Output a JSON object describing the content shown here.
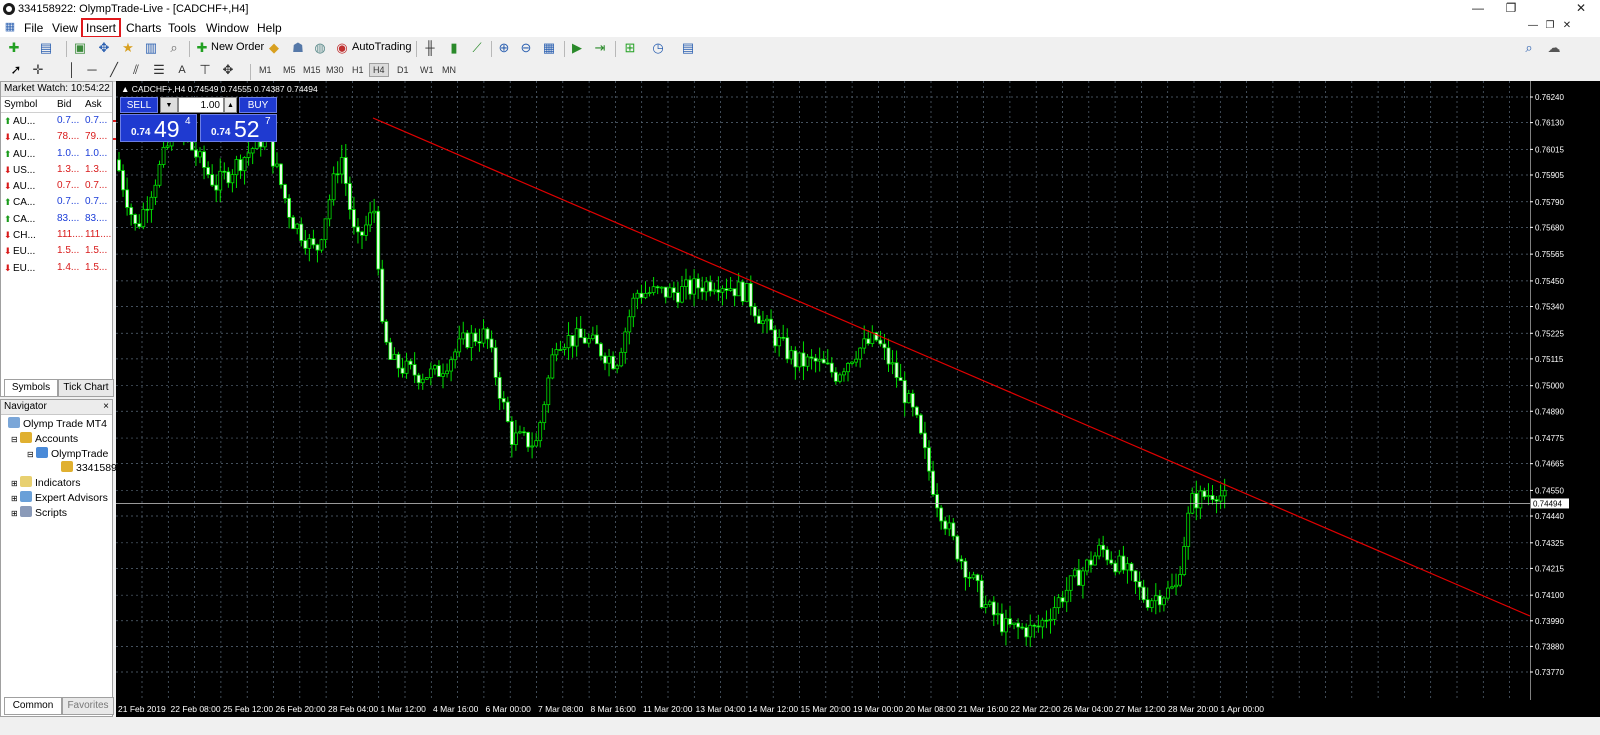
{
  "window": {
    "title": "334158922: OlympTrade-Live - [CADCHF+,H4]",
    "controls": [
      "—",
      "❐",
      "✕"
    ],
    "inner_controls": [
      "—",
      "❐",
      "✕"
    ]
  },
  "menu": {
    "items": [
      "File",
      "View",
      "Insert",
      "Charts",
      "Tools",
      "Window",
      "Help"
    ],
    "selected": "Insert"
  },
  "toolbar": {
    "new_order": "New Order",
    "autotrading": "AutoTrading"
  },
  "timeframes": [
    "M1",
    "M5",
    "M15",
    "M30",
    "H1",
    "H4",
    "D1",
    "W1",
    "MN"
  ],
  "active_timeframe": "H4",
  "market_watch": {
    "title": "Market Watch: 10:54:22",
    "columns": [
      "Symbol",
      "Bid",
      "Ask"
    ],
    "rows": [
      {
        "symbol": "AU...",
        "bid": "0.7...",
        "ask": "0.7...",
        "dir": "up",
        "color": "blue"
      },
      {
        "symbol": "AU...",
        "bid": "78....",
        "ask": "79....",
        "dir": "down",
        "color": "red"
      },
      {
        "symbol": "AU...",
        "bid": "1.0...",
        "ask": "1.0...",
        "dir": "up",
        "color": "blue"
      },
      {
        "symbol": "US...",
        "bid": "1.3...",
        "ask": "1.3...",
        "dir": "down",
        "color": "red"
      },
      {
        "symbol": "AU...",
        "bid": "0.7...",
        "ask": "0.7...",
        "dir": "down",
        "color": "red"
      },
      {
        "symbol": "CA...",
        "bid": "0.7...",
        "ask": "0.7...",
        "dir": "up",
        "color": "blue"
      },
      {
        "symbol": "CA...",
        "bid": "83....",
        "ask": "83....",
        "dir": "up",
        "color": "blue"
      },
      {
        "symbol": "CH...",
        "bid": "111....",
        "ask": "111....",
        "dir": "down",
        "color": "red"
      },
      {
        "symbol": "EU...",
        "bid": "1.5...",
        "ask": "1.5...",
        "dir": "down",
        "color": "red"
      },
      {
        "symbol": "EU...",
        "bid": "1.4...",
        "ask": "1.5...",
        "dir": "down",
        "color": "red"
      }
    ],
    "tabs": [
      "Symbols",
      "Tick Chart"
    ]
  },
  "navigator": {
    "title": "Navigator",
    "items": [
      "Olymp Trade MT4",
      "Accounts",
      "OlympTrade",
      "3341589",
      "Indicators",
      "Expert Advisors",
      "Scripts"
    ],
    "tabs": [
      "Common",
      "Favorites"
    ]
  },
  "chart": {
    "symbol_info": "▲ CADCHF+,H4  0.74549 0.74555 0.74387 0.74494",
    "trade": {
      "sell": "SELL",
      "buy": "BUY",
      "lot": "1.00",
      "bid_prefix": "0.74",
      "bid_big": "49",
      "bid_sup": "4",
      "ask_prefix": "0.74",
      "ask_big": "52",
      "ask_sup": "7"
    },
    "current_price_label": "0.74494",
    "price_labels": [
      "0.76240",
      "0.76130",
      "0.76015",
      "0.75905",
      "0.75790",
      "0.75680",
      "0.75565",
      "0.75450",
      "0.75340",
      "0.75225",
      "0.75115",
      "0.75000",
      "0.74890",
      "0.74775",
      "0.74665",
      "0.74550",
      "0.74440",
      "0.74325",
      "0.74215",
      "0.74100",
      "0.73990",
      "0.73880",
      "0.73770"
    ],
    "time_labels": [
      "21 Feb 2019",
      "22 Feb 08:00",
      "25 Feb 12:00",
      "26 Feb 20:00",
      "28 Feb 04:00",
      "1 Mar 12:00",
      "4 Mar 16:00",
      "6 Mar 00:00",
      "7 Mar 08:00",
      "8 Mar 16:00",
      "11 Mar 20:00",
      "13 Mar 04:00",
      "14 Mar 12:00",
      "15 Mar 20:00",
      "19 Mar 00:00",
      "20 Mar 08:00",
      "21 Mar 16:00",
      "22 Mar 22:00",
      "26 Mar 04:00",
      "27 Mar 12:00",
      "28 Mar 20:00",
      "1 Apr 00:00"
    ],
    "colors": {
      "background": "#000000",
      "grid": "#5a6a7a",
      "bull": "#e8ffe8",
      "bear": "#00e000",
      "trendline": "#e00000"
    }
  }
}
